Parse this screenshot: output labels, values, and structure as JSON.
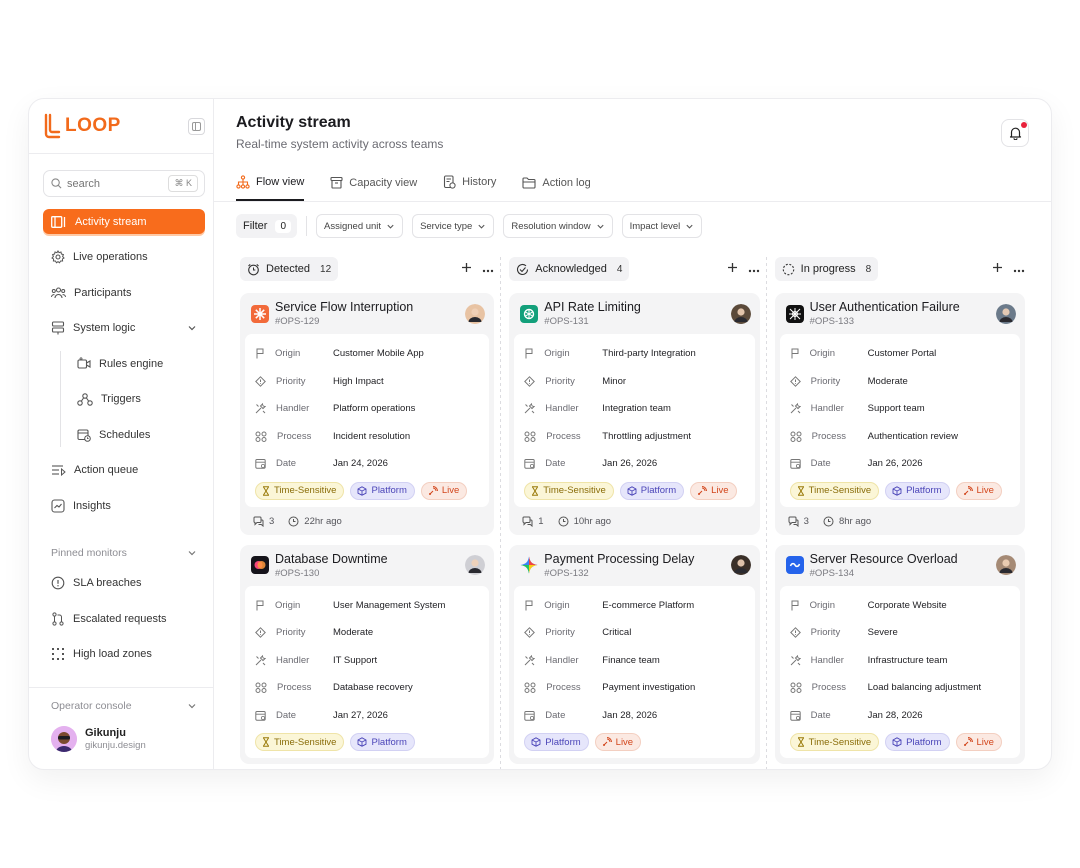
{
  "brand": {
    "name": "LOOP",
    "accent": "#f86c1c"
  },
  "sidebar": {
    "search_placeholder": "search",
    "search_shortcut": "⌘ K",
    "items": [
      {
        "label": "Activity stream",
        "icon": "columns-icon"
      },
      {
        "label": "Live operations",
        "icon": "gear-icon"
      },
      {
        "label": "Participants",
        "icon": "users-icon"
      },
      {
        "label": "System logic",
        "icon": "server-icon"
      }
    ],
    "subitems": [
      {
        "label": "Rules engine"
      },
      {
        "label": "Triggers"
      },
      {
        "label": "Schedules"
      }
    ],
    "items2": [
      {
        "label": "Action queue"
      },
      {
        "label": "Insights"
      }
    ],
    "pinned_title": "Pinned monitors",
    "pinned": [
      {
        "label": "SLA breaches"
      },
      {
        "label": "Escalated requests"
      },
      {
        "label": "High load zones"
      }
    ],
    "console_title": "Operator console",
    "user": {
      "name": "Gikunju",
      "email": "gikunju.design"
    }
  },
  "header": {
    "title": "Activity stream",
    "subtitle": "Real-time system activity across teams"
  },
  "tabs": [
    {
      "label": "Flow view"
    },
    {
      "label": "Capacity view"
    },
    {
      "label": "History"
    },
    {
      "label": "Action log"
    }
  ],
  "filters": {
    "filter_label": "Filter",
    "filter_count": "0",
    "dropdowns": [
      "Assigned unit",
      "Service type",
      "Resolution window",
      "Impact level"
    ]
  },
  "labels": {
    "origin": "Origin",
    "priority": "Priority",
    "handler": "Handler",
    "process": "Process",
    "date": "Date",
    "time_sensitive": "Time-Sensitive",
    "platform": "Platform",
    "live": "Live"
  },
  "columns": [
    {
      "title": "Detected",
      "count": "12",
      "cards": [
        {
          "title": "Service Flow Interruption",
          "id": "#OPS-129",
          "origin": "Customer Mobile App",
          "priority": "High Impact",
          "handler": "Platform operations",
          "process": "Incident resolution",
          "date": "Jan 24, 2026",
          "comments": "3",
          "time": "22hr ago"
        },
        {
          "title": "Database Downtime",
          "id": "#OPS-130",
          "origin": "User Management System",
          "priority": "Moderate",
          "handler": "IT Support",
          "process": "Database recovery",
          "date": "Jan 27, 2026"
        }
      ]
    },
    {
      "title": "Acknowledged",
      "count": "4",
      "cards": [
        {
          "title": "API Rate Limiting",
          "id": "#OPS-131",
          "origin": "Third-party Integration",
          "priority": "Minor",
          "handler": "Integration team",
          "process": "Throttling adjustment",
          "date": "Jan 26, 2026",
          "comments": "1",
          "time": "10hr ago"
        },
        {
          "title": "Payment Processing Delay",
          "id": "#OPS-132",
          "origin": "E-commerce Platform",
          "priority": "Critical",
          "handler": "Finance team",
          "process": "Payment investigation",
          "date": "Jan 28, 2026"
        }
      ]
    },
    {
      "title": "In progress",
      "count": "8",
      "cards": [
        {
          "title": "User Authentication Failure",
          "id": "#OPS-133",
          "origin": "Customer Portal",
          "priority": "Moderate",
          "handler": "Support team",
          "process": "Authentication review",
          "date": "Jan 26, 2026",
          "comments": "3",
          "time": "8hr ago"
        },
        {
          "title": "Server Resource Overload",
          "id": "#OPS-134",
          "origin": "Corporate Website",
          "priority": "Severe",
          "handler": "Infrastructure team",
          "process": "Load balancing adjustment",
          "date": "Jan 28, 2026"
        }
      ]
    }
  ]
}
